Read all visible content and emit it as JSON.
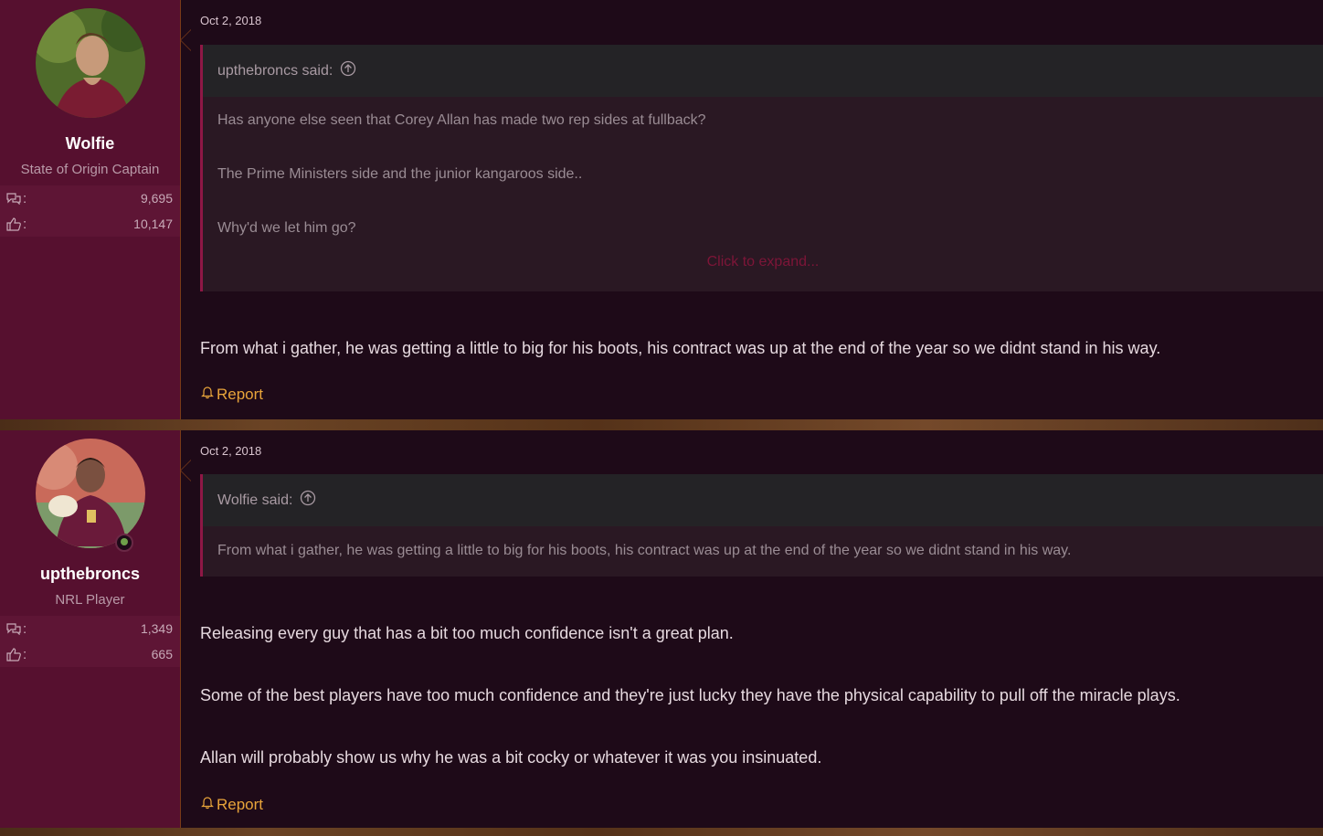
{
  "posts": [
    {
      "username": "Wolfie",
      "user_title": "State of Origin Captain",
      "messages_count": "9,695",
      "reactions_count": "10,147",
      "date": "Oct 2, 2018",
      "quote": {
        "author_line": "upthebroncs said:",
        "lines": [
          "Has anyone else seen that Corey Allan has made two rep sides at fullback?",
          "The Prime Ministers side and the junior kangaroos side..",
          "Why'd we let him go?"
        ],
        "expand_label": "Click to expand..."
      },
      "body": [
        "From what i gather, he was getting a little to big for his boots, his contract was up at the end of the year so we didnt stand in his way."
      ],
      "report_label": "Report",
      "online": false
    },
    {
      "username": "upthebroncs",
      "user_title": "NRL Player",
      "messages_count": "1,349",
      "reactions_count": "665",
      "date": "Oct 2, 2018",
      "quote": {
        "author_line": "Wolfie said:",
        "lines": [
          "From what i gather, he was getting a little to big for his boots, his contract was up at the end of the year so we didnt stand in his way."
        ]
      },
      "body": [
        "Releasing every guy that has a bit too much confidence isn't a great plan.",
        "Some of the best players have too much confidence and they're just lucky they have the physical capability to pull off the miracle plays.",
        "Allan will probably show us why he was a bit cocky or whatever it was you insinuated."
      ],
      "report_label": "Report",
      "online": true
    }
  ],
  "stat_labels": {
    "messages_suffix": ":",
    "reactions_suffix": ":"
  },
  "colors": {
    "user_panel": "#56102f",
    "post_bg": "#1e0a18",
    "quote_accent": "#8e1745",
    "report": "#e8a43a",
    "expand": "#7d1538"
  }
}
